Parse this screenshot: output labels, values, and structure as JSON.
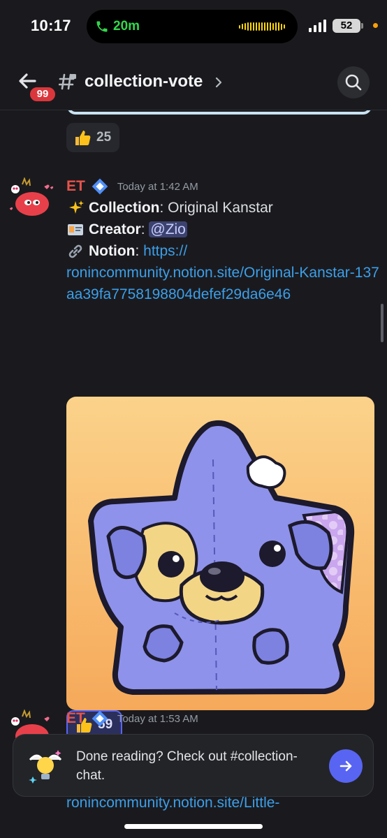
{
  "status_bar": {
    "time": "10:17",
    "call_duration": "20m",
    "battery": "52"
  },
  "header": {
    "unread_badge": "99",
    "channel_name": "collection-vote"
  },
  "reactions": {
    "prev_count": "25",
    "main_count": "59"
  },
  "message1": {
    "author": "ET",
    "timestamp": "Today at 1:42 AM",
    "collection_label": "Collection",
    "collection_value": ": Original Kanstar",
    "creator_label": "Creator",
    "creator_sep": ": ",
    "creator_mention": "@Zio",
    "notion_label": "Notion",
    "notion_sep": ": ",
    "notion_link_start": "https://",
    "notion_link_rest": "ronincommunity.notion.site/Original-Kanstar-137aa39fa7758198804defef29da6e46"
  },
  "message2": {
    "author": "ET",
    "timestamp": "Today at 1:53 AM",
    "partial_link": "ronincommunity.notion.site/Little-"
  },
  "prompt": {
    "text": "Done reading? Check out #collection-chat."
  },
  "colors": {
    "accent": "#5865f2",
    "author": "#e5534b",
    "link": "#3c9fe9",
    "badge": "#da373c"
  }
}
